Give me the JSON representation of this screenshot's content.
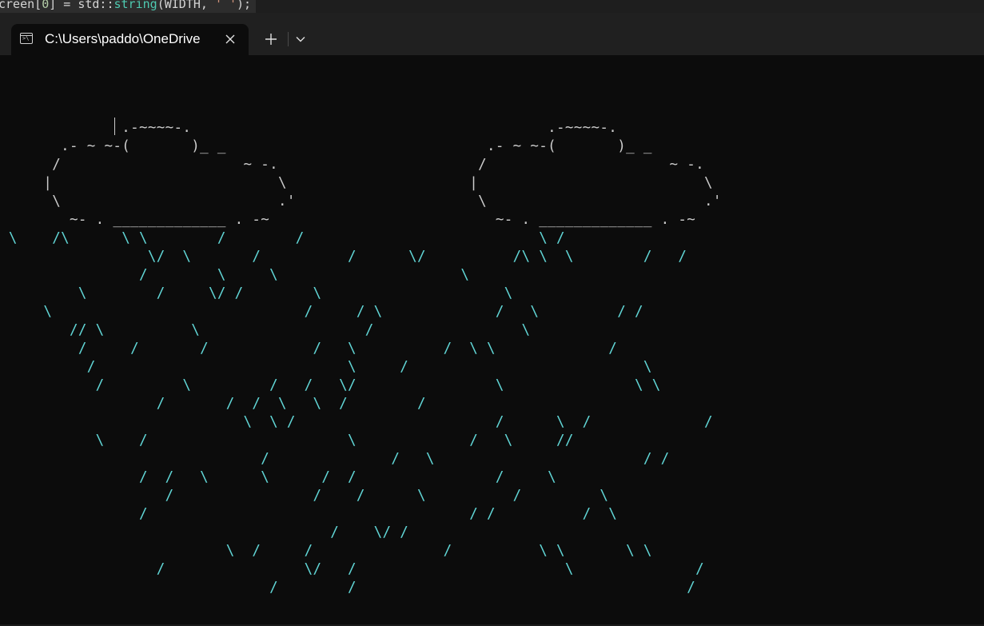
{
  "editor_peek": {
    "code_line": "creen[0] = std::string(WIDTH, ' ');",
    "parts": {
      "a": "creen[",
      "b": "0",
      "c": "] = std::",
      "d": "string",
      "e": "(WIDTH, ",
      "f": "' '",
      "g": ");"
    }
  },
  "window": {
    "tab": {
      "title": "C:\\Users\\paddo\\OneDrive",
      "icon": "terminal-icon",
      "close_icon": "close-icon"
    },
    "new_tab_icon": "plus-icon",
    "dropdown_icon": "chevron-down-icon"
  },
  "terminal": {
    "colors": {
      "background": "#0c0c0c",
      "cloud": "#cccccc",
      "rain": "#61d6d6"
    },
    "cloud_art": "              .-~~~~-.                                         .-~~~~-.\n       .- ~ ~-(       )_ _                              .- ~ ~-(       )_ _\n      /                     ~ -.                       /                     ~ -.\n     |                          \\                     |                          \\\n      \\                         .'                     \\                         .'\n        ~- . _____________ . -~                          ~- . _____________ . -~",
    "rain_art": " \\    /\\      \\ \\        /        /                           \\ /\n                 \\/  \\       /          /      \\/          /\\ \\  \\        /   /\n                /        \\     \\                     \\\n         \\        /     \\/ /        \\                     \\\n     \\                             /     / \\             /   \\         / /\n        // \\          \\                   /                 \\\n         /     /       /            /   \\          /  \\ \\             /\n          /                             \\     /                           \\\n           /         \\         /   /   \\/                \\               \\ \\\n                  /       /  /  \\   \\  /        /\n                            \\  \\ /                       /      \\  /             /\n           \\    /                       \\             /   \\     //\n                              /              /   \\                        / /\n                /  /   \\      \\      /  /                /     \\\n                   /                /    /      \\          /         \\\n                /                                     / /          /  \\\n                                      /    \\/ /\n                          \\  /     /               /          \\ \\       \\ \\\n                  /                \\/   /                        \\              /\n                               /        /                                      /"
  }
}
